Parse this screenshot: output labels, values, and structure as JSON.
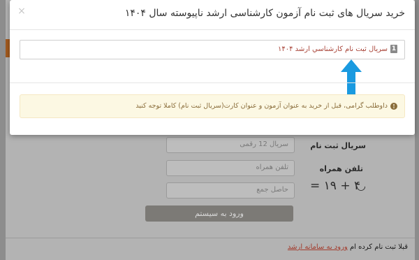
{
  "modal": {
    "title": "خرید سریال های ثبت نام آزمون کارشناسی ارشد ناپیوسته سال ۱۴۰۴",
    "close_glyph": "×",
    "items": [
      {
        "number": "1",
        "label": "سریال ثبت نام کارشناسي ارشد ۱۴۰۴"
      }
    ],
    "alert": {
      "icon": "info-circle-icon",
      "text": "داوطلب گرامی، قبل از خرید به عنوان آزمون و عنوان کارت(سریال ثبت نام) کاملا توجه کنید"
    },
    "arrow_icon": "arrow-up-icon",
    "arrow_color": "#1a9ae0"
  },
  "background_form": {
    "serial_label": "سریال ثبت نام",
    "serial_placeholder": "سریال 12 رقمی",
    "phone_label": "تلفن همراه",
    "phone_placeholder": "تلفن همراه",
    "captcha_text": "= ۱۹ + ۴",
    "sum_placeholder": "حاصل جمع",
    "submit_label": "ورود به سیستم",
    "footer_text": "قبلا ثبت نام کرده ام",
    "footer_link": "ورود به سامانه ارشد"
  }
}
